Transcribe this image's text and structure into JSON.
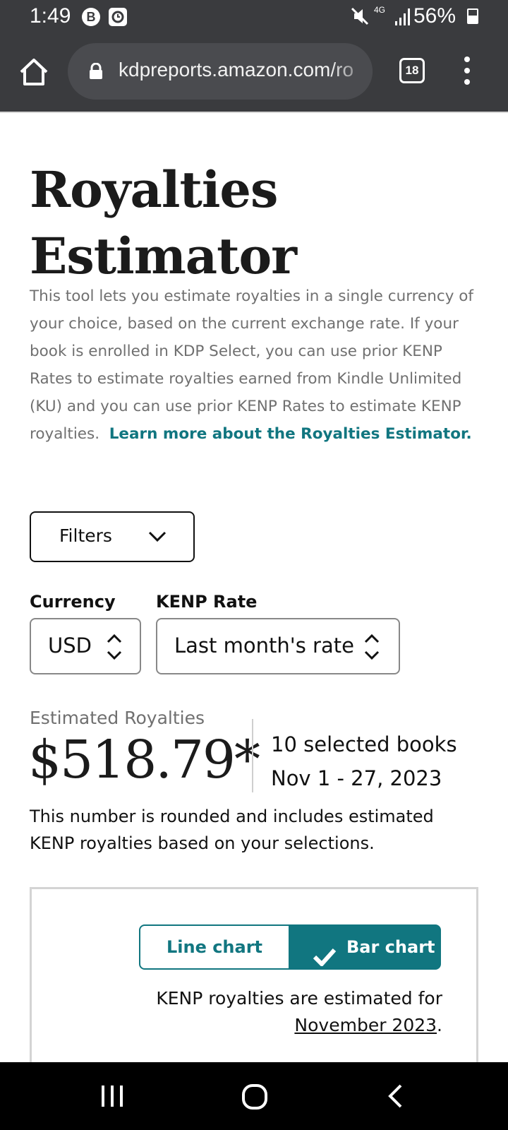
{
  "status_bar": {
    "time": "1:49",
    "notif_badge_1": "B",
    "battery": "56%",
    "battery_level": 0.56,
    "network": "4G",
    "icons": [
      "mute-icon",
      "signal-icon",
      "battery-icon"
    ]
  },
  "browser": {
    "url": "kdpreports.amazon.com/ro",
    "tab_count": "18",
    "icons": [
      "home-icon",
      "lock-icon",
      "tabs-icon",
      "menu-icon"
    ]
  },
  "page": {
    "title": "Royalties Estimator",
    "description": "This tool lets you estimate royalties in a single currency of your choice, based on the current exchange rate. If your book is enrolled in KDP Select, you can use prior KENP Rates to estimate royalties earned from Kindle Unlimited (KU) and you can use prior KENP Rates to estimate KENP royalties.",
    "learn_more_link": "Learn more about the Royalties Estimator."
  },
  "filters": {
    "label": "Filters"
  },
  "currency": {
    "label": "Currency",
    "value": "USD"
  },
  "kenp_rate": {
    "label": "KENP Rate",
    "value": "Last month's rate"
  },
  "estimate": {
    "label": "Estimated Royalties",
    "amount": "$518.79*",
    "books": "10 selected books",
    "date_range": "Nov 1 - 27, 2023",
    "note": "This number is rounded and includes estimated KENP royalties based on your selections."
  },
  "chart_toggle": {
    "line_label": "Line chart",
    "bar_label": "Bar chart",
    "selected": "Bar chart"
  },
  "kenp_note": {
    "prefix": "KENP royalties are estimated for",
    "month_link": "November 2023",
    "suffix": "."
  },
  "colors": {
    "accent": "#117680",
    "chrome": "#3a3b3e",
    "muted_text": "#707070"
  }
}
